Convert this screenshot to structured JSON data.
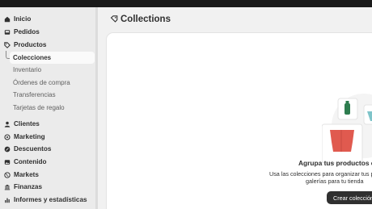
{
  "nav": {
    "items": [
      {
        "label": "Inicio",
        "icon": "home-icon"
      },
      {
        "label": "Pedidos",
        "icon": "inbox-icon"
      },
      {
        "label": "Productos",
        "icon": "tag-icon"
      },
      {
        "label": "Clientes",
        "icon": "person-icon"
      },
      {
        "label": "Marketing",
        "icon": "target-icon"
      },
      {
        "label": "Descuentos",
        "icon": "discount-icon"
      },
      {
        "label": "Contenido",
        "icon": "image-icon"
      },
      {
        "label": "Markets",
        "icon": "globe-icon"
      },
      {
        "label": "Finanzas",
        "icon": "bank-icon"
      },
      {
        "label": "Informes y estadísticas",
        "icon": "chart-icon"
      }
    ],
    "sub_items": [
      {
        "label": "Colecciones",
        "active": true
      },
      {
        "label": "Inventario",
        "active": false
      },
      {
        "label": "Órdenes de compra",
        "active": false
      },
      {
        "label": "Transferencias",
        "active": false
      },
      {
        "label": "Tarjetas de regalo",
        "active": false
      }
    ]
  },
  "page": {
    "title": "Collections",
    "empty_state": {
      "title": "Agrupa tus productos en",
      "desc_line1": "Usa las colecciones para organizar tus p",
      "desc_line2": "galerías para tu tienda",
      "cta": "Crear colección"
    }
  },
  "colors": {
    "sidebar_bg": "#ebebeb",
    "main_bg": "#f1f1f1",
    "card_bg": "#ffffff",
    "cta_bg": "#303030",
    "illustration_red": "#e05a4f",
    "illustration_green": "#2e7d4f",
    "illustration_teal": "#7fc4c9"
  }
}
